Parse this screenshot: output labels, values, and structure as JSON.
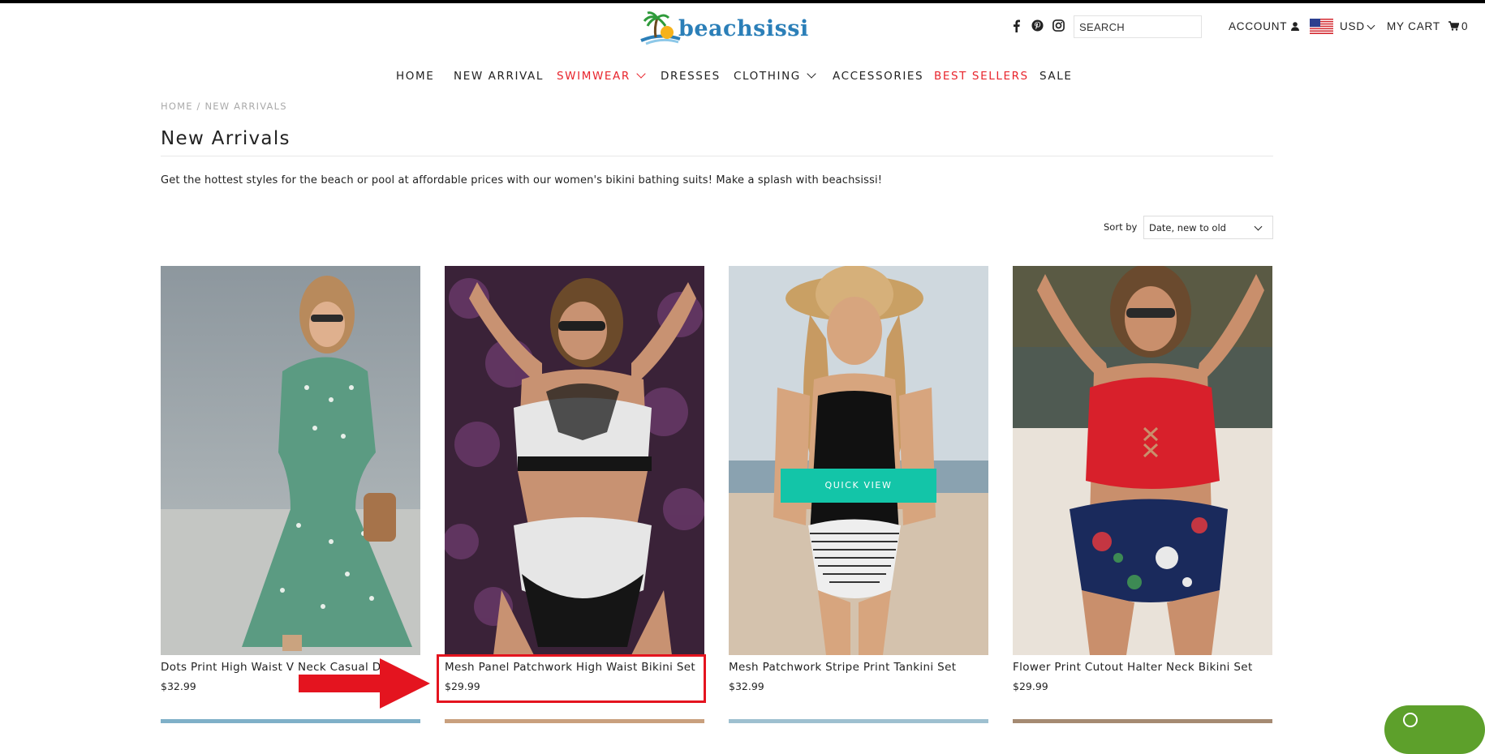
{
  "header": {
    "logo_text": "beachsissi",
    "search_placeholder": "SEARCH",
    "account_label": "ACCOUNT",
    "currency": "USD",
    "cart_label": "MY CART",
    "cart_count": "0"
  },
  "nav": {
    "items": [
      {
        "label": "HOME"
      },
      {
        "label": "NEW ARRIVAL"
      },
      {
        "label": "SWIMWEAR"
      },
      {
        "label": "DRESSES"
      },
      {
        "label": "CLOTHING"
      },
      {
        "label": "ACCESSORIES"
      },
      {
        "label": "BEST SELLERS"
      },
      {
        "label": "SALE"
      }
    ]
  },
  "breadcrumb": "HOME / NEW ARRIVALS",
  "page": {
    "title": "New Arrivals",
    "description": "Get the hottest styles for the beach or pool at affordable prices with our women's bikini bathing suits! Make a splash with beachsissi!"
  },
  "sort": {
    "label": "Sort by",
    "selected": "Date, new to old"
  },
  "products": [
    {
      "name": "Dots Print High Waist V Neck Casual D",
      "price": "$32.99"
    },
    {
      "name": "Mesh Panel Patchwork High Waist Bikini Set",
      "price": "$29.99"
    },
    {
      "name": "Mesh Patchwork Stripe Print Tankini Set",
      "price": "$32.99"
    },
    {
      "name": "Flower Print Cutout Halter Neck Bikini Set",
      "price": "$29.99"
    }
  ],
  "quick_view_label": "QUICK VIEW",
  "colors": {
    "accent_red": "#e8242c",
    "quick_view_teal": "#13c5a8",
    "annotation_red": "#e4141f",
    "chat_green": "#5da02b"
  }
}
